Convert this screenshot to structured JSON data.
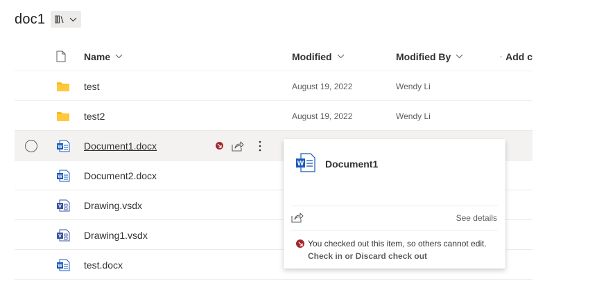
{
  "library": {
    "title": "doc1",
    "view_icon": "library-view-icon"
  },
  "columns": {
    "name": "Name",
    "modified": "Modified",
    "modified_by": "Modified By",
    "add_column": "Add c"
  },
  "rows": [
    {
      "name": "test",
      "type": "folder",
      "modified": "August 19, 2022",
      "modified_by": "Wendy Li"
    },
    {
      "name": "test2",
      "type": "folder",
      "modified": "August 19, 2022",
      "modified_by": "Wendy Li"
    },
    {
      "name": "Document1.docx",
      "type": "word",
      "modified": "",
      "modified_by": "",
      "selected": true,
      "checked_out": true
    },
    {
      "name": "Document2.docx",
      "type": "word",
      "modified": "",
      "modified_by": ""
    },
    {
      "name": "Drawing.vsdx",
      "type": "visio",
      "modified": "",
      "modified_by": ""
    },
    {
      "name": "Drawing1.vsdx",
      "type": "visio",
      "modified": "",
      "modified_by": ""
    },
    {
      "name": "test.docx",
      "type": "word",
      "modified": "",
      "modified_by": ""
    }
  ],
  "hover_card": {
    "title": "Document1",
    "see_details": "See details",
    "checkout_message": "You checked out this item, so others cannot edit.",
    "checkout_actions": "Check in or Discard check out"
  },
  "colors": {
    "folder": "#ffb900",
    "word": "#185abd",
    "visio": "#3955a3",
    "checkout": "#a4262c",
    "selected_row": "#f3f2f1"
  }
}
